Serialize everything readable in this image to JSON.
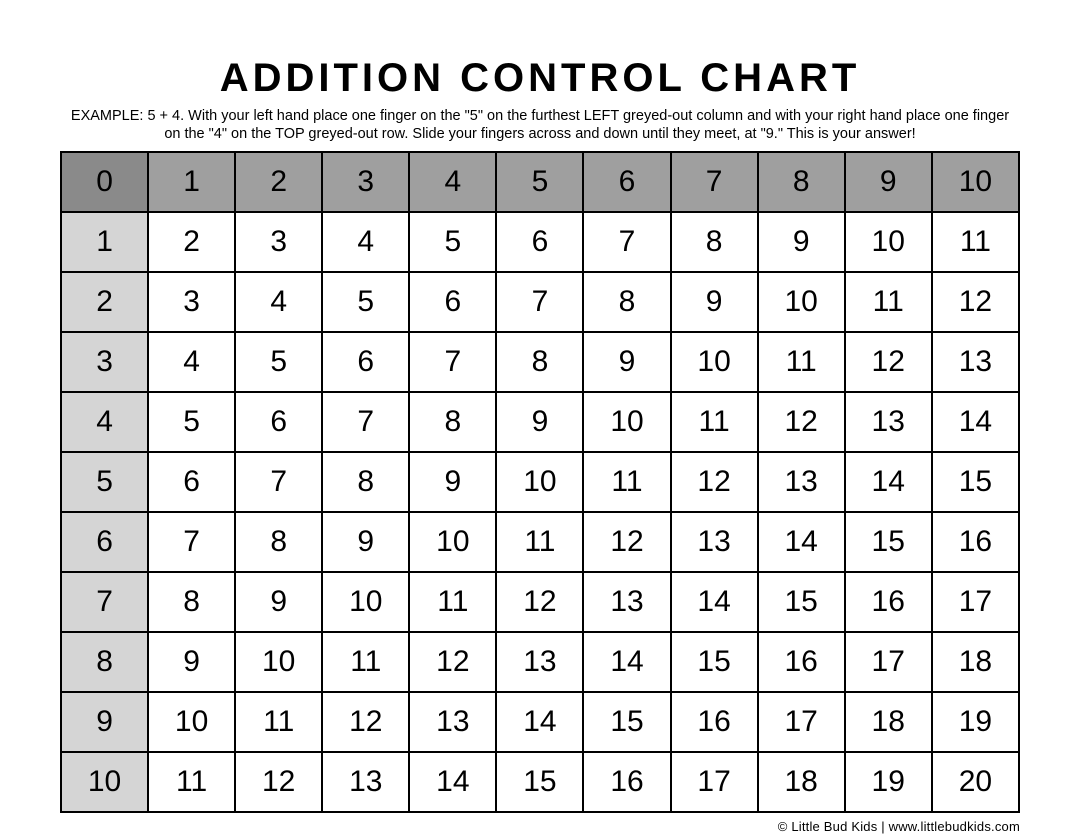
{
  "title": "ADDITION CONTROL CHART",
  "subtitle": "EXAMPLE: 5 + 4. With your left hand place one finger on the \"5\" on the furthest LEFT greyed-out column and with your right hand place one finger on the \"4\" on the TOP greyed-out row.  Slide your fingers across and down until they meet, at \"9.\" This is your answer!",
  "footer": "© Little Bud Kids  |  www.littlebudkids.com",
  "chart_data": {
    "type": "table",
    "title": "Addition Control Chart (0–10)",
    "columns": [
      0,
      1,
      2,
      3,
      4,
      5,
      6,
      7,
      8,
      9,
      10
    ],
    "rows": [
      {
        "header": 1,
        "values": [
          2,
          3,
          4,
          5,
          6,
          7,
          8,
          9,
          10,
          11
        ]
      },
      {
        "header": 2,
        "values": [
          3,
          4,
          5,
          6,
          7,
          8,
          9,
          10,
          11,
          12
        ]
      },
      {
        "header": 3,
        "values": [
          4,
          5,
          6,
          7,
          8,
          9,
          10,
          11,
          12,
          13
        ]
      },
      {
        "header": 4,
        "values": [
          5,
          6,
          7,
          8,
          9,
          10,
          11,
          12,
          13,
          14
        ]
      },
      {
        "header": 5,
        "values": [
          6,
          7,
          8,
          9,
          10,
          11,
          12,
          13,
          14,
          15
        ]
      },
      {
        "header": 6,
        "values": [
          7,
          8,
          9,
          10,
          11,
          12,
          13,
          14,
          15,
          16
        ]
      },
      {
        "header": 7,
        "values": [
          8,
          9,
          10,
          11,
          12,
          13,
          14,
          15,
          16,
          17
        ]
      },
      {
        "header": 8,
        "values": [
          9,
          10,
          11,
          12,
          13,
          14,
          15,
          16,
          17,
          18
        ]
      },
      {
        "header": 9,
        "values": [
          10,
          11,
          12,
          13,
          14,
          15,
          16,
          17,
          18,
          19
        ]
      },
      {
        "header": 10,
        "values": [
          11,
          12,
          13,
          14,
          15,
          16,
          17,
          18,
          19,
          20
        ]
      }
    ]
  }
}
